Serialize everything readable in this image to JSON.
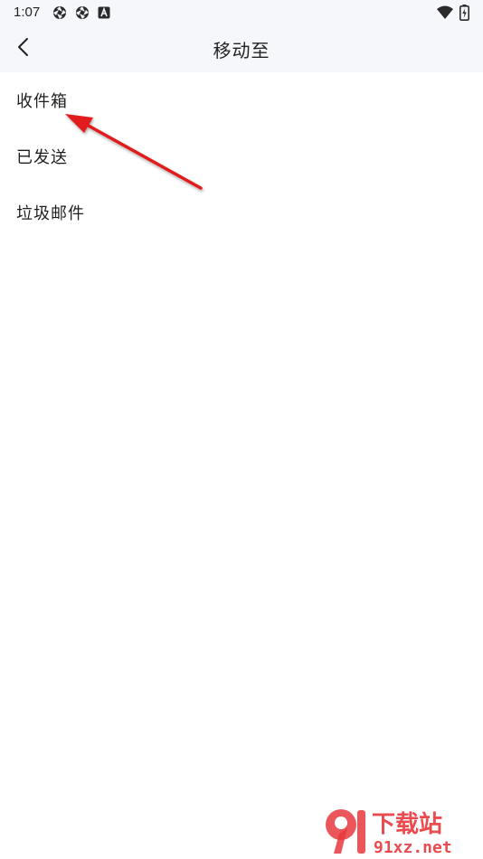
{
  "status_bar": {
    "time": "1:07",
    "left_icons": [
      "aperture-icon",
      "aperture-icon",
      "a-badge-icon"
    ],
    "right_icons": [
      "wifi-icon",
      "battery-charging-icon"
    ]
  },
  "header": {
    "back_icon": "chevron-left-icon",
    "title": "移动至"
  },
  "folders": [
    {
      "label": "收件箱"
    },
    {
      "label": "已发送"
    },
    {
      "label": "垃圾邮件"
    }
  ],
  "annotation": {
    "type": "red-arrow",
    "color": "#e01b1b",
    "points_to": "收件箱"
  },
  "watermark": {
    "brand": "下载站",
    "domain": "91xz.net",
    "logo_text": "9",
    "color": "#e8383d"
  },
  "colors": {
    "header_bg": "#f6f7fb",
    "page_bg": "#ffffff",
    "text": "#1f1f1f"
  }
}
